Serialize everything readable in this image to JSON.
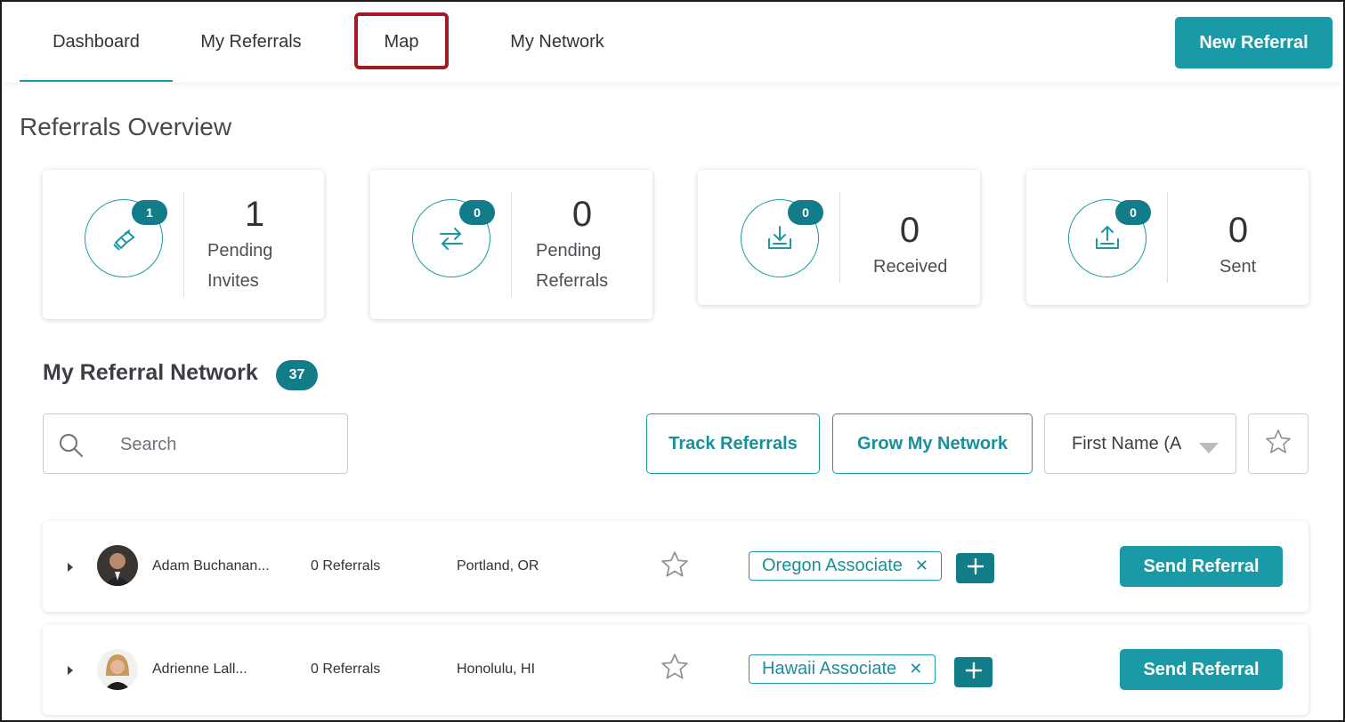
{
  "nav": {
    "tabs": [
      {
        "label": "Dashboard"
      },
      {
        "label": "My Referrals"
      },
      {
        "label": "Map"
      },
      {
        "label": "My Network"
      }
    ],
    "active_tab": "Dashboard",
    "highlighted_tab": "Map",
    "new_referral_label": "New Referral"
  },
  "overview": {
    "title": "Referrals Overview",
    "cards": [
      {
        "badge": "1",
        "value": "1",
        "label_line1": "Pending",
        "label_line2": "Invites",
        "icon": "handshake-icon"
      },
      {
        "badge": "0",
        "value": "0",
        "label_line1": "Pending",
        "label_line2": "Referrals",
        "icon": "swap-arrows-icon"
      },
      {
        "badge": "0",
        "value": "0",
        "label_line1": "Received",
        "label_line2": "",
        "icon": "inbox-download-icon"
      },
      {
        "badge": "0",
        "value": "0",
        "label_line1": "Sent",
        "label_line2": "",
        "icon": "inbox-upload-icon"
      }
    ]
  },
  "network": {
    "title": "My Referral Network",
    "count": "37",
    "search_placeholder": "Search",
    "track_referrals_label": "Track Referrals",
    "grow_network_label": "Grow My Network",
    "sort_value": "First Name (A",
    "rows": [
      {
        "name": "Adam Buchanan...",
        "referrals": "0 Referrals",
        "location": "Portland, OR",
        "tag": "Oregon Associate",
        "send_label": "Send Referral"
      },
      {
        "name": "Adrienne Lall...",
        "referrals": "0 Referrals",
        "location": "Honolulu, HI",
        "tag": "Hawaii Associate",
        "send_label": "Send Referral"
      }
    ]
  },
  "colors": {
    "accent": "#1a9aa6",
    "accent_dark": "#127c89",
    "highlight_border": "#a11a1f"
  }
}
